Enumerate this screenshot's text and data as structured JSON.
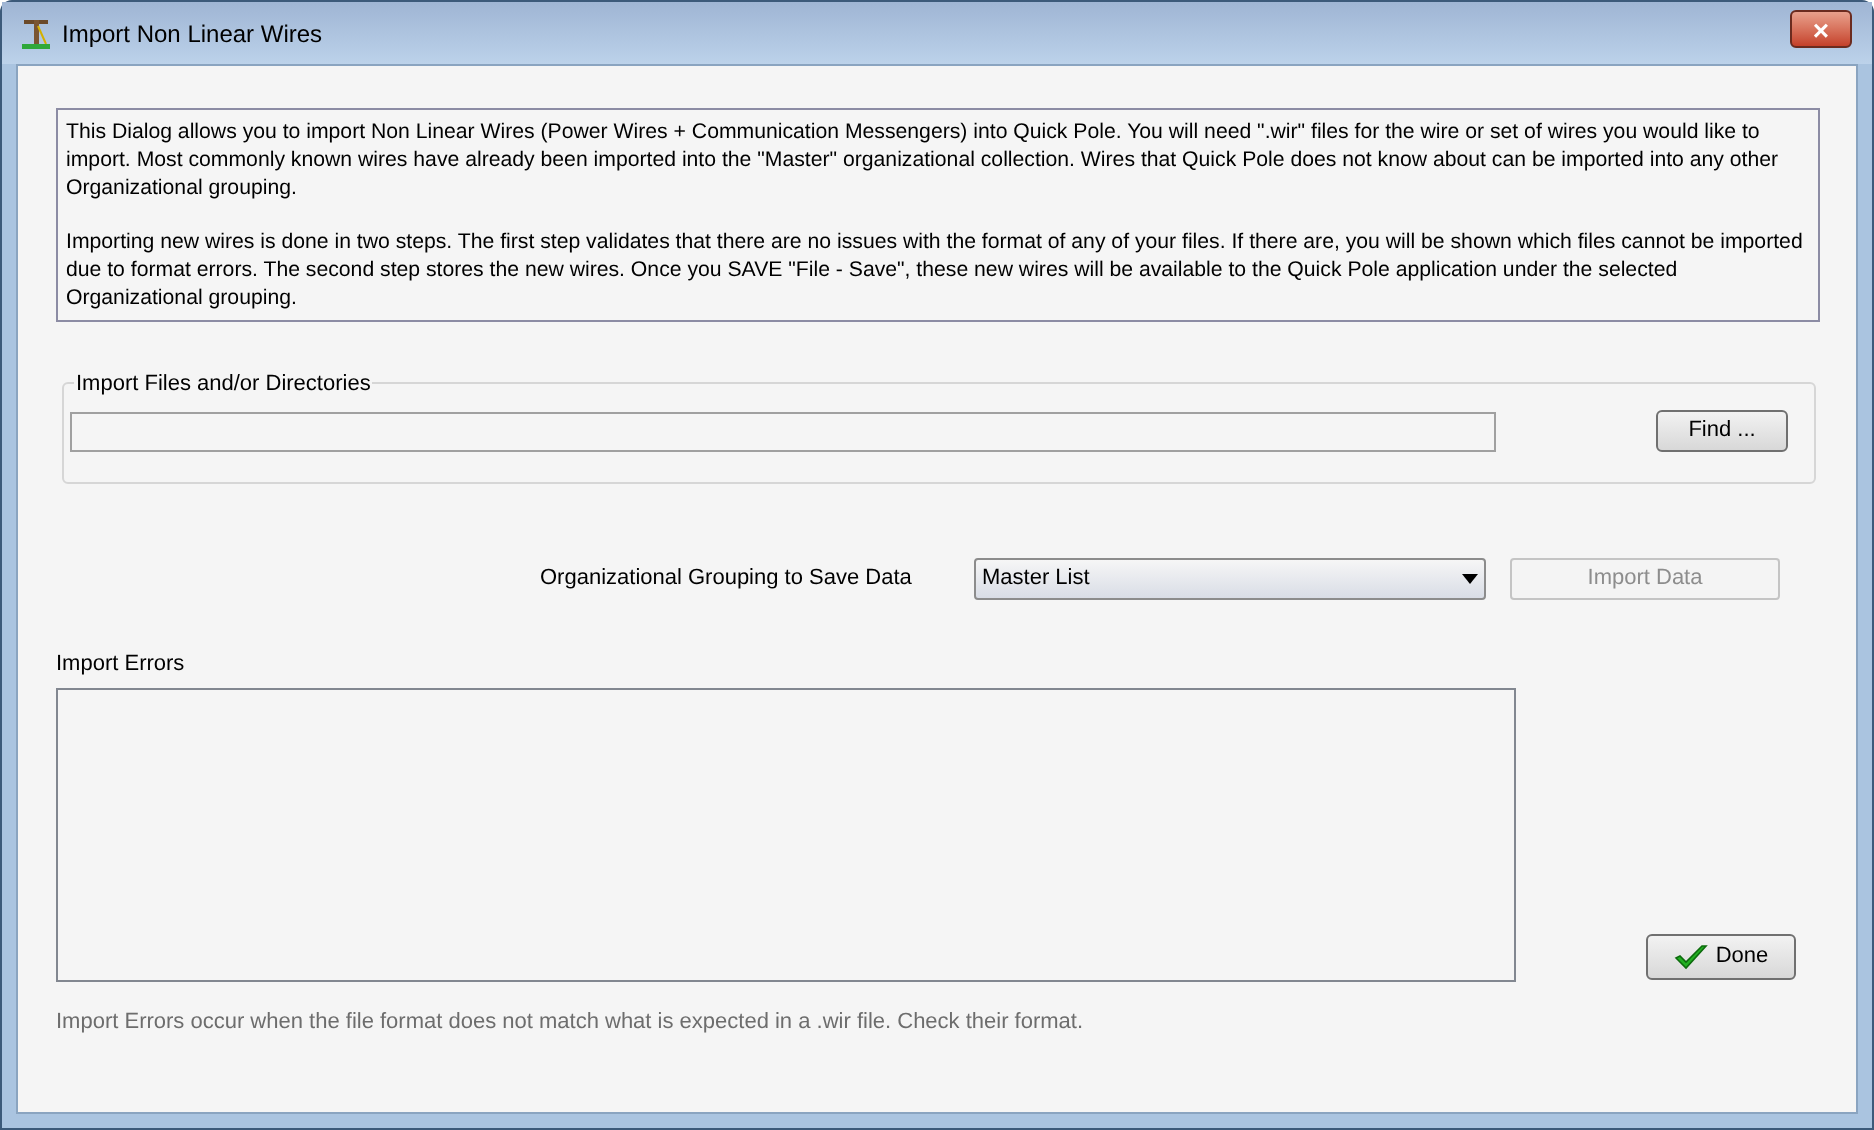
{
  "window": {
    "title": "Import Non Linear Wires",
    "close": "×"
  },
  "intro": [
    "This Dialog allows you to import Non Linear Wires (Power Wires + Communication Messengers) into Quick Pole. You will need \".wir\" files for the wire or set of wires you would like to import. Most commonly known wires have already been imported into the \"Master\" organizational collection. Wires that Quick Pole does not know about can be imported into any other Organizational grouping.",
    "Importing new wires is done in two steps. The first step validates that there are no issues with the format of any of your files. If there are, you will be shown which files cannot be imported due to format errors. The second step stores the new wires. Once you SAVE \"File - Save\", these new wires will be available to the Quick Pole application under the selected Organizational grouping."
  ],
  "files_group": {
    "title": "Import Files and/or Directories",
    "find_button": {
      "label": "Find ...",
      "disabled": false
    }
  },
  "grouping": {
    "label": "Organizational Grouping to Save Data",
    "value": "Master List"
  },
  "import_button": {
    "label": "Import Data",
    "disabled": true
  },
  "errors": {
    "label": "Import Errors",
    "note": "Import Errors occur when the file format does not match what is expected in a .wir file. Check their format."
  },
  "done_button": {
    "label": "Done",
    "disabled": false
  }
}
